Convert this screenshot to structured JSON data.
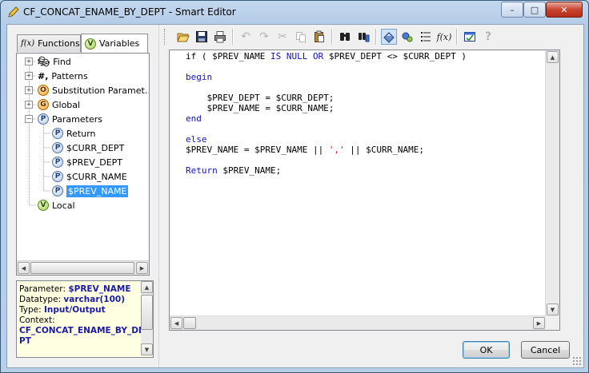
{
  "window": {
    "title": "CF_CONCAT_ENAME_BY_DEPT - Smart Editor",
    "minimize": "–",
    "maximize": "□",
    "close": "✕"
  },
  "tabs": [
    {
      "label": "Functions",
      "icon": "fx-icon",
      "icon_text": "f(x)"
    },
    {
      "label": "Variables",
      "icon": "variables-icon",
      "icon_text": "V"
    }
  ],
  "tree": {
    "items": [
      {
        "label": "Find",
        "icon": "binoculars-icon",
        "glyph": "👓"
      },
      {
        "label": "Patterns",
        "icon": "patterns-icon",
        "glyph": "#."
      },
      {
        "label": "Substitution Paramet…",
        "icon": "substitution-icon",
        "glyph": "O"
      },
      {
        "label": "Global",
        "icon": "global-icon",
        "glyph": "G"
      },
      {
        "label": "Parameters",
        "icon": "parameters-icon",
        "glyph": "P"
      },
      {
        "label": "Return",
        "icon": "param-icon",
        "glyph": "P"
      },
      {
        "label": "$CURR_DEPT",
        "icon": "param-icon",
        "glyph": "P"
      },
      {
        "label": "$PREV_DEPT",
        "icon": "param-icon",
        "glyph": "P"
      },
      {
        "label": "$CURR_NAME",
        "icon": "param-icon",
        "glyph": "P"
      },
      {
        "label": "$PREV_NAME",
        "icon": "param-icon",
        "glyph": "P"
      },
      {
        "label": "Local",
        "icon": "local-icon",
        "glyph": "V"
      }
    ]
  },
  "info": {
    "parameter_label": "Parameter:",
    "parameter_value": "$PREV_NAME",
    "datatype_label": "Datatype:",
    "datatype_value": "varchar(100)",
    "type_label": "Type:",
    "type_value": "Input/Output",
    "context_label": "Context:",
    "context_value_1": "CF_CONCAT_ENAME_BY_DE",
    "context_value_2": "PT"
  },
  "toolbar": {
    "buttons": [
      "open-icon",
      "save-icon",
      "print-icon",
      "undo-icon",
      "redo-icon",
      "cut-icon",
      "copy-icon",
      "paste-icon",
      "find-icon",
      "find-replace-icon",
      "toggle-view-icon",
      "variables-panel-icon",
      "list-icon",
      "function-icon",
      "validate-icon",
      "help-icon"
    ]
  },
  "code": {
    "l1_a": "if ( $PREV_NAME ",
    "l1_b": "IS NULL OR",
    "l1_c": " $PREV_DEPT <> $CURR_DEPT )",
    "l2": "begin",
    "l3": "    $PREV_DEPT = $CURR_DEPT;",
    "l4": "    $PREV_NAME = $CURR_NAME;",
    "l5": "end",
    "l6": "else",
    "l7_a": "$PREV_NAME = $PREV_NAME || ",
    "l7_b": "','",
    "l7_c": " || $CURR_NAME;",
    "l8_a": "Return",
    "l8_b": " $PREV_NAME;"
  },
  "buttons": {
    "ok": "OK",
    "cancel": "Cancel"
  }
}
